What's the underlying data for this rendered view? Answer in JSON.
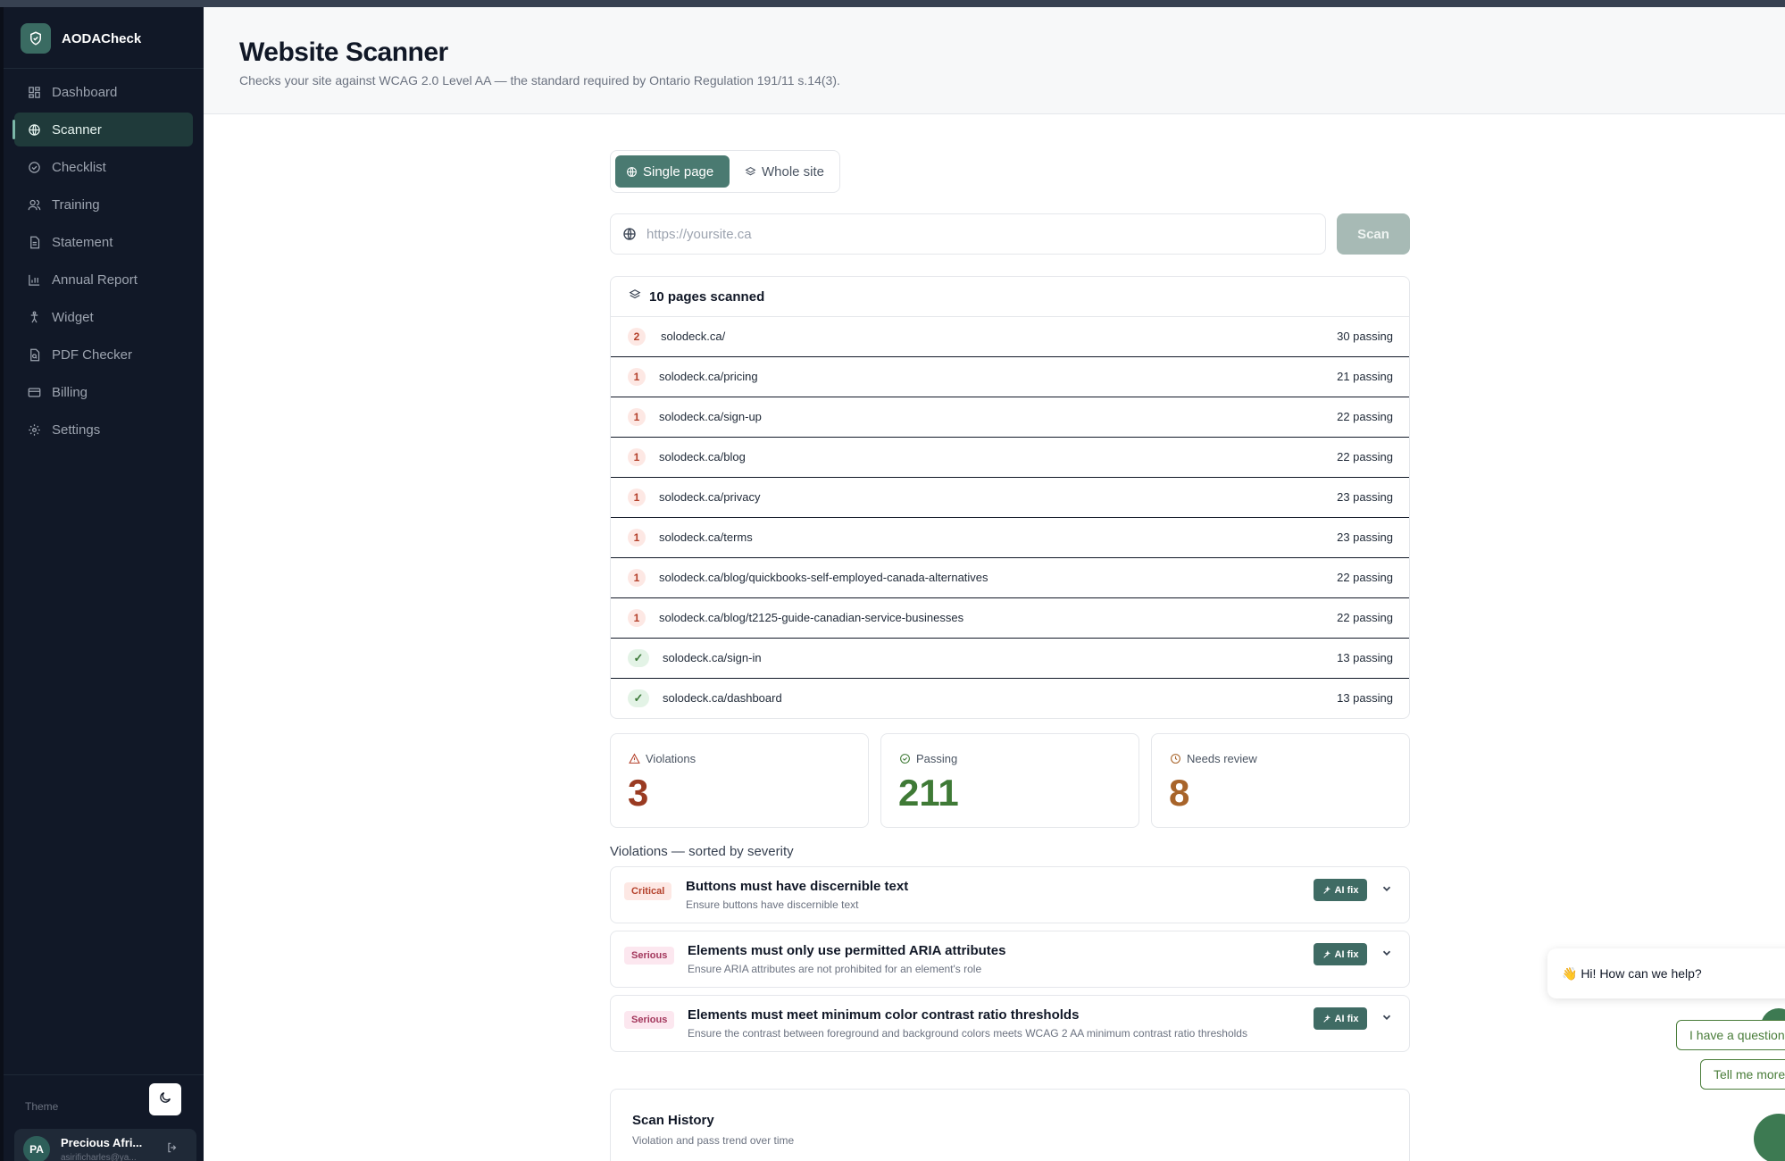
{
  "app": {
    "name": "AODACheck"
  },
  "sidebar": {
    "items": [
      {
        "label": "Dashboard",
        "icon": "dashboard-icon"
      },
      {
        "label": "Scanner",
        "icon": "globe-icon"
      },
      {
        "label": "Checklist",
        "icon": "check-circle-icon"
      },
      {
        "label": "Training",
        "icon": "users-icon"
      },
      {
        "label": "Statement",
        "icon": "document-icon"
      },
      {
        "label": "Annual Report",
        "icon": "bar-chart-icon"
      },
      {
        "label": "Widget",
        "icon": "accessibility-icon"
      },
      {
        "label": "PDF Checker",
        "icon": "file-search-icon"
      },
      {
        "label": "Billing",
        "icon": "credit-card-icon"
      },
      {
        "label": "Settings",
        "icon": "gear-icon"
      }
    ],
    "active": "Scanner",
    "theme_label": "Theme",
    "user": {
      "initials": "PA",
      "name": "Precious Afri...",
      "email": "asirificharles@ya..."
    }
  },
  "header": {
    "title": "Website Scanner",
    "subtitle": "Checks your site against WCAG 2.0 Level AA — the standard required by Ontario Regulation 191/11 s.14(3)."
  },
  "scanner": {
    "modes": {
      "single": "Single page",
      "whole": "Whole site",
      "selected": "Single page"
    },
    "url_placeholder": "https://yoursite.ca",
    "url_value": "",
    "scan_label": "Scan"
  },
  "pages": {
    "title": "10 pages scanned",
    "rows": [
      {
        "violations": "2",
        "url": "solodeck.ca/",
        "passing": "30 passing"
      },
      {
        "violations": "1",
        "url": "solodeck.ca/pricing",
        "passing": "21 passing"
      },
      {
        "violations": "1",
        "url": "solodeck.ca/sign-up",
        "passing": "22 passing"
      },
      {
        "violations": "1",
        "url": "solodeck.ca/blog",
        "passing": "22 passing"
      },
      {
        "violations": "1",
        "url": "solodeck.ca/privacy",
        "passing": "23 passing"
      },
      {
        "violations": "1",
        "url": "solodeck.ca/terms",
        "passing": "23 passing"
      },
      {
        "violations": "1",
        "url": "solodeck.ca/blog/quickbooks-self-employed-canada-alternatives",
        "passing": "22 passing"
      },
      {
        "violations": "1",
        "url": "solodeck.ca/blog/t2125-guide-canadian-service-businesses",
        "passing": "22 passing"
      },
      {
        "violations": "✓",
        "url": "solodeck.ca/sign-in",
        "passing": "13 passing"
      },
      {
        "violations": "✓",
        "url": "solodeck.ca/dashboard",
        "passing": "13 passing"
      }
    ]
  },
  "stats": {
    "violations": {
      "label": "Violations",
      "value": "3",
      "color": "#9a3b22"
    },
    "passing": {
      "label": "Passing",
      "value": "211",
      "color": "#3f7a36"
    },
    "review": {
      "label": "Needs review",
      "value": "8",
      "color": "#a8642a"
    }
  },
  "violations": {
    "section_title": "Violations — sorted by severity",
    "ai_fix_label": "AI fix",
    "items": [
      {
        "severity": "Critical",
        "title": "Buttons must have discernible text",
        "desc": "Ensure buttons have discernible text"
      },
      {
        "severity": "Serious",
        "title": "Elements must only use permitted ARIA attributes",
        "desc": "Ensure ARIA attributes are not prohibited for an element's role"
      },
      {
        "severity": "Serious",
        "title": "Elements must meet minimum color contrast ratio thresholds",
        "desc": "Ensure the contrast between foreground and background colors meets WCAG 2 AA minimum contrast ratio thresholds"
      }
    ]
  },
  "history": {
    "title": "Scan History",
    "subtitle": "Violation and pass trend over time"
  },
  "chat": {
    "greeting": "👋 Hi! How can we help?",
    "options": [
      "I have a question",
      "Tell me more"
    ]
  }
}
